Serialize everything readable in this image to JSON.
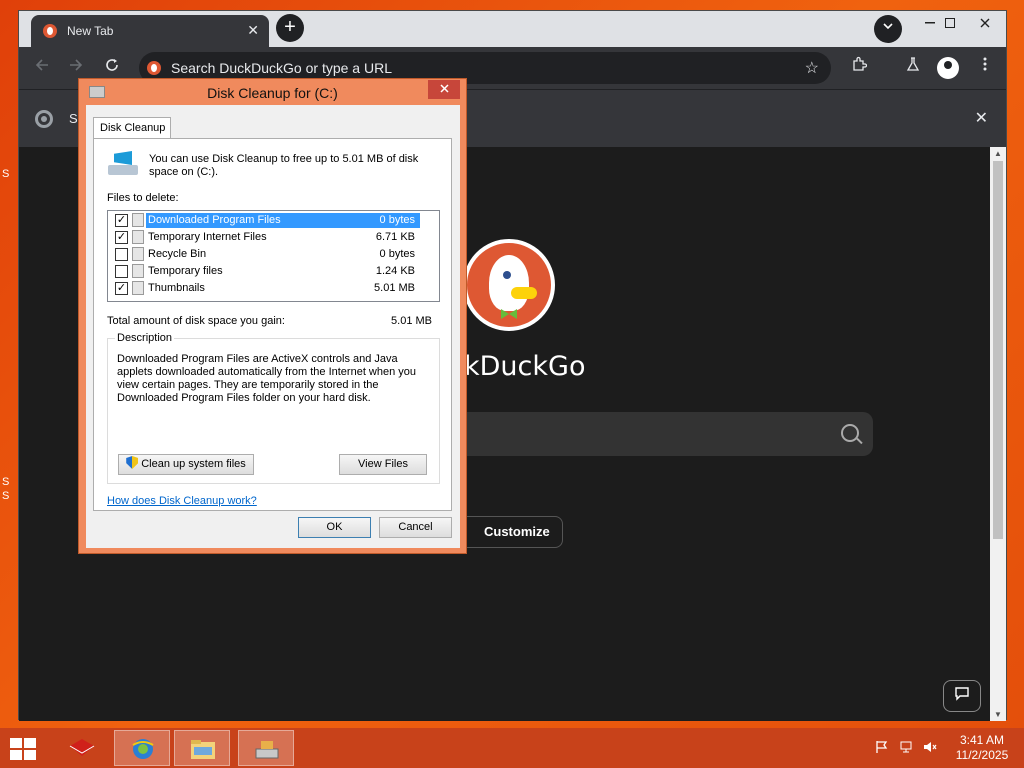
{
  "browser": {
    "tab_title": "New Tab",
    "omnibox_placeholder": "Search DuckDuckGo or type a URL",
    "infobar_text": "S",
    "new_tab_symbol": "+",
    "tab_close_symbol": "✕",
    "infobar_close_symbol": "✕"
  },
  "ddg": {
    "wordmark": "kDuckGo",
    "customize_label": "Customize"
  },
  "desktop_edge": {
    "left_1": "S",
    "left_2": "S",
    "left_3": "S"
  },
  "dialog": {
    "title": "Disk Cleanup for  (C:)",
    "tab_label": "Disk Cleanup",
    "intro": "You can use Disk Cleanup to free up to 5.01 MB of disk space on  (C:).",
    "files_label": "Files to delete:",
    "files": [
      {
        "name": "Downloaded Program Files",
        "size": "0 bytes",
        "checked": true,
        "selected": true
      },
      {
        "name": "Temporary Internet Files",
        "size": "6.71 KB",
        "checked": true,
        "selected": false
      },
      {
        "name": "Recycle Bin",
        "size": "0 bytes",
        "checked": false,
        "selected": false
      },
      {
        "name": "Temporary files",
        "size": "1.24 KB",
        "checked": false,
        "selected": false
      },
      {
        "name": "Thumbnails",
        "size": "5.01 MB",
        "checked": true,
        "selected": false
      }
    ],
    "total_label": "Total amount of disk space you gain:",
    "total_value": "5.01 MB",
    "description_legend": "Description",
    "description_text": "Downloaded Program Files are ActiveX controls and Java applets downloaded automatically from the Internet when you view certain pages. They are temporarily stored in the Downloaded Program Files folder on your hard disk.",
    "cleanup_system_label": "Clean up system files",
    "view_files_label": "View Files",
    "help_link": "How does Disk Cleanup work?",
    "ok_label": "OK",
    "cancel_label": "Cancel"
  },
  "taskbar": {
    "clock_time": "3:41 AM",
    "clock_date": "11/2/2025"
  },
  "colors": {
    "desktop": "#e85a0e",
    "taskbar": "#c8421a",
    "dialog_frame": "#f08a5d",
    "selection": "#3399ff"
  }
}
